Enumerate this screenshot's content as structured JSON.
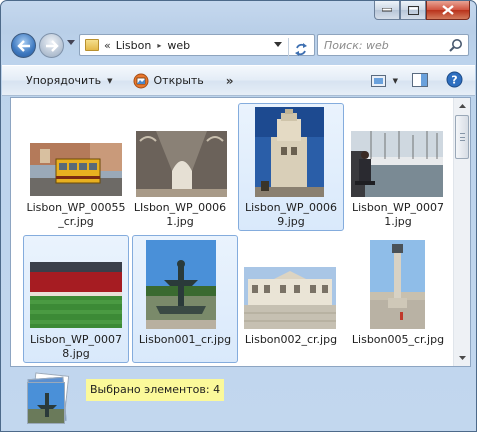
{
  "window": {
    "minimize_icon": "minimize-icon",
    "maximize_icon": "maximize-icon",
    "close_icon": "close-icon"
  },
  "nav": {
    "back_icon": "back-arrow-icon",
    "forward_icon": "forward-arrow-icon"
  },
  "address": {
    "overflow_glyph": "«",
    "segments": [
      "Lisbon",
      "web"
    ],
    "separator": "▸"
  },
  "search": {
    "placeholder": "Поиск: web"
  },
  "toolbar": {
    "organize_label": "Упорядочить",
    "open_label": "Открыть",
    "more_label": "»",
    "dropdown_glyph": "▼"
  },
  "files": [
    {
      "name": "Lisbon_WP_00055_cr.jpg",
      "selected": true,
      "thumb": "tram"
    },
    {
      "name": "LIsbon_WP_00061.jpg",
      "selected": false,
      "thumb": "cloister"
    },
    {
      "name": "Lisbon_WP_00069.jpg",
      "selected": true,
      "thumb": "tower"
    },
    {
      "name": "Lisbon_WP_00071.jpg",
      "selected": false,
      "thumb": "harbor"
    },
    {
      "name": "Lisbon_WP_00078.jpg",
      "selected": true,
      "thumb": "stadium"
    },
    {
      "name": "Lisbon001_cr.jpg",
      "selected": true,
      "thumb": "fountain"
    },
    {
      "name": "Lisbon002_cr.jpg",
      "selected": false,
      "thumb": "square"
    },
    {
      "name": "Lisbon005_cr.jpg",
      "selected": false,
      "thumb": "column"
    }
  ],
  "status": {
    "text": "Выбрано элементов: 4"
  },
  "colors": {
    "selection_fill": "#d9e9fb",
    "selection_border": "#84acdd",
    "status_highlight": "#fbf99a"
  }
}
